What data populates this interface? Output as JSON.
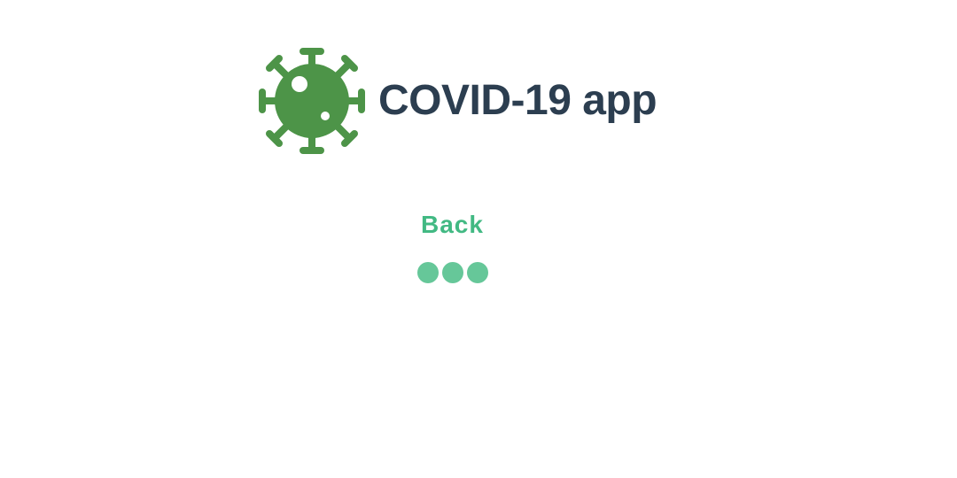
{
  "header": {
    "title": "COVID-19 app",
    "logo_icon": "virus-icon"
  },
  "nav": {
    "back_label": "Back"
  },
  "loader": {
    "icon": "loading-dots-icon",
    "dot_count": 3
  },
  "colors": {
    "logo": "#4d9448",
    "title": "#2c3e50",
    "back_link": "#42b983",
    "loader_dots": "#66c799",
    "background": "#ffffff"
  }
}
